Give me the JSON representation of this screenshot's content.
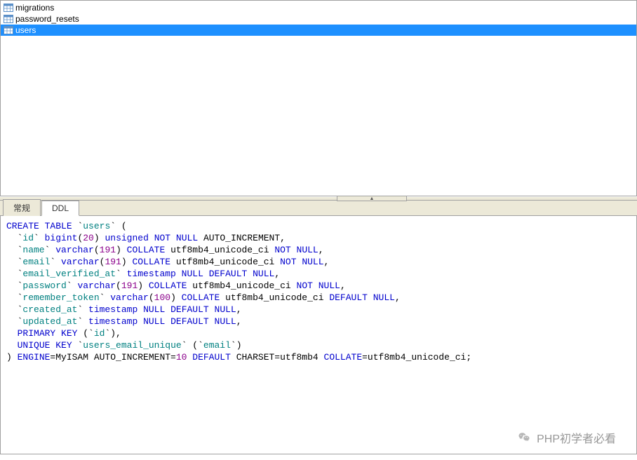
{
  "tree": {
    "items": [
      {
        "label": "migrations",
        "selected": false
      },
      {
        "label": "password_resets",
        "selected": false
      },
      {
        "label": "users",
        "selected": true
      }
    ]
  },
  "tabs": {
    "items": [
      {
        "label": "常规",
        "active": false
      },
      {
        "label": "DDL",
        "active": true
      }
    ]
  },
  "ddl": {
    "tokens": [
      [
        {
          "t": "CREATE",
          "c": "kw"
        },
        {
          "t": " "
        },
        {
          "t": "TABLE",
          "c": "kw"
        },
        {
          "t": " `"
        },
        {
          "t": "users",
          "c": "ident"
        },
        {
          "t": "` ("
        }
      ],
      [
        {
          "t": "  `"
        },
        {
          "t": "id",
          "c": "ident"
        },
        {
          "t": "` "
        },
        {
          "t": "bigint",
          "c": "kw"
        },
        {
          "t": "("
        },
        {
          "t": "20",
          "c": "num"
        },
        {
          "t": ") "
        },
        {
          "t": "unsigned",
          "c": "kw"
        },
        {
          "t": " "
        },
        {
          "t": "NOT",
          "c": "kw"
        },
        {
          "t": " "
        },
        {
          "t": "NULL",
          "c": "kw"
        },
        {
          "t": " AUTO_INCREMENT,"
        }
      ],
      [
        {
          "t": "  `"
        },
        {
          "t": "name",
          "c": "ident"
        },
        {
          "t": "` "
        },
        {
          "t": "varchar",
          "c": "kw"
        },
        {
          "t": "("
        },
        {
          "t": "191",
          "c": "num"
        },
        {
          "t": ") "
        },
        {
          "t": "COLLATE",
          "c": "kw"
        },
        {
          "t": " utf8mb4_unicode_ci "
        },
        {
          "t": "NOT",
          "c": "kw"
        },
        {
          "t": " "
        },
        {
          "t": "NULL",
          "c": "kw"
        },
        {
          "t": ","
        }
      ],
      [
        {
          "t": "  `"
        },
        {
          "t": "email",
          "c": "ident"
        },
        {
          "t": "` "
        },
        {
          "t": "varchar",
          "c": "kw"
        },
        {
          "t": "("
        },
        {
          "t": "191",
          "c": "num"
        },
        {
          "t": ") "
        },
        {
          "t": "COLLATE",
          "c": "kw"
        },
        {
          "t": " utf8mb4_unicode_ci "
        },
        {
          "t": "NOT",
          "c": "kw"
        },
        {
          "t": " "
        },
        {
          "t": "NULL",
          "c": "kw"
        },
        {
          "t": ","
        }
      ],
      [
        {
          "t": "  `"
        },
        {
          "t": "email_verified_at",
          "c": "ident"
        },
        {
          "t": "` "
        },
        {
          "t": "timestamp",
          "c": "kw"
        },
        {
          "t": " "
        },
        {
          "t": "NULL",
          "c": "kw"
        },
        {
          "t": " "
        },
        {
          "t": "DEFAULT",
          "c": "kw"
        },
        {
          "t": " "
        },
        {
          "t": "NULL",
          "c": "kw"
        },
        {
          "t": ","
        }
      ],
      [
        {
          "t": "  `"
        },
        {
          "t": "password",
          "c": "ident"
        },
        {
          "t": "` "
        },
        {
          "t": "varchar",
          "c": "kw"
        },
        {
          "t": "("
        },
        {
          "t": "191",
          "c": "num"
        },
        {
          "t": ") "
        },
        {
          "t": "COLLATE",
          "c": "kw"
        },
        {
          "t": " utf8mb4_unicode_ci "
        },
        {
          "t": "NOT",
          "c": "kw"
        },
        {
          "t": " "
        },
        {
          "t": "NULL",
          "c": "kw"
        },
        {
          "t": ","
        }
      ],
      [
        {
          "t": "  `"
        },
        {
          "t": "remember_token",
          "c": "ident"
        },
        {
          "t": "` "
        },
        {
          "t": "varchar",
          "c": "kw"
        },
        {
          "t": "("
        },
        {
          "t": "100",
          "c": "num"
        },
        {
          "t": ") "
        },
        {
          "t": "COLLATE",
          "c": "kw"
        },
        {
          "t": " utf8mb4_unicode_ci "
        },
        {
          "t": "DEFAULT",
          "c": "kw"
        },
        {
          "t": " "
        },
        {
          "t": "NULL",
          "c": "kw"
        },
        {
          "t": ","
        }
      ],
      [
        {
          "t": "  `"
        },
        {
          "t": "created_at",
          "c": "ident"
        },
        {
          "t": "` "
        },
        {
          "t": "timestamp",
          "c": "kw"
        },
        {
          "t": " "
        },
        {
          "t": "NULL",
          "c": "kw"
        },
        {
          "t": " "
        },
        {
          "t": "DEFAULT",
          "c": "kw"
        },
        {
          "t": " "
        },
        {
          "t": "NULL",
          "c": "kw"
        },
        {
          "t": ","
        }
      ],
      [
        {
          "t": "  `"
        },
        {
          "t": "updated_at",
          "c": "ident"
        },
        {
          "t": "` "
        },
        {
          "t": "timestamp",
          "c": "kw"
        },
        {
          "t": " "
        },
        {
          "t": "NULL",
          "c": "kw"
        },
        {
          "t": " "
        },
        {
          "t": "DEFAULT",
          "c": "kw"
        },
        {
          "t": " "
        },
        {
          "t": "NULL",
          "c": "kw"
        },
        {
          "t": ","
        }
      ],
      [
        {
          "t": "  "
        },
        {
          "t": "PRIMARY",
          "c": "kw"
        },
        {
          "t": " "
        },
        {
          "t": "KEY",
          "c": "kw"
        },
        {
          "t": " (`"
        },
        {
          "t": "id",
          "c": "ident"
        },
        {
          "t": "`),"
        }
      ],
      [
        {
          "t": "  "
        },
        {
          "t": "UNIQUE",
          "c": "kw"
        },
        {
          "t": " "
        },
        {
          "t": "KEY",
          "c": "kw"
        },
        {
          "t": " `"
        },
        {
          "t": "users_email_unique",
          "c": "ident"
        },
        {
          "t": "` (`"
        },
        {
          "t": "email",
          "c": "ident"
        },
        {
          "t": "`)"
        }
      ],
      [
        {
          "t": ") "
        },
        {
          "t": "ENGINE",
          "c": "kw"
        },
        {
          "t": "=MyISAM AUTO_INCREMENT="
        },
        {
          "t": "10",
          "c": "num"
        },
        {
          "t": " "
        },
        {
          "t": "DEFAULT",
          "c": "kw"
        },
        {
          "t": " CHARSET=utf8mb4 "
        },
        {
          "t": "COLLATE",
          "c": "kw"
        },
        {
          "t": "=utf8mb4_unicode_ci;"
        }
      ]
    ]
  },
  "watermark": {
    "text": "PHP初学者必看"
  }
}
